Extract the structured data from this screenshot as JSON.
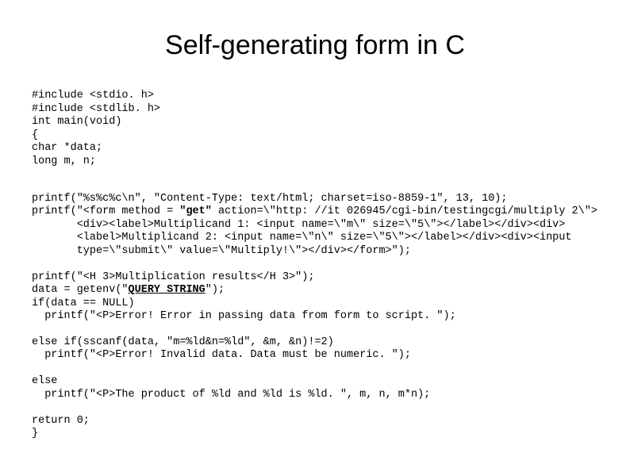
{
  "title": "Self-generating form in C",
  "code": {
    "l1": "#include <stdio. h>",
    "l2": "#include <stdlib. h>",
    "l3": "int main(void)",
    "l4": "{",
    "l5": "char *data;",
    "l6": "long m, n;",
    "l7": "printf(\"%s%c%c\\n\", \"Content-Type: text/html; charset=iso-8859-1\", 13, 10);",
    "l8a": "printf(\"<form method = ",
    "l8b": "\"get\"",
    "l8c": " action=\\\"http: //it 026945/cgi-bin/testingcgi/multiply 2\\\"><div><label>Multiplicand 1: <input name=\\\"m\\\" size=\\\"5\\\"></label></div><div><label>Multiplicand 2: <input name=\\\"n\\\" size=\\\"5\\\"></label></div><div><input type=\\\"submit\\\" value=\\\"Multiply!\\\"></div></form>\");",
    "l9": "printf(\"<H 3>Multiplication results</H 3>\");",
    "l10a": "data = getenv(\"",
    "l10b": "QUERY_STRING",
    "l10c": "\");",
    "l11": "if(data == NULL)",
    "l12": "  printf(\"<P>Error! Error in passing data from form to script. \");",
    "l13": "else if(sscanf(data, \"m=%ld&n=%ld\", &m, &n)!=2)",
    "l14": "  printf(\"<P>Error! Invalid data. Data must be numeric. \");",
    "l15": "else",
    "l16": "  printf(\"<P>The product of %ld and %ld is %ld. \", m, n, m*n);",
    "l17": "return 0;",
    "l18": "}"
  }
}
